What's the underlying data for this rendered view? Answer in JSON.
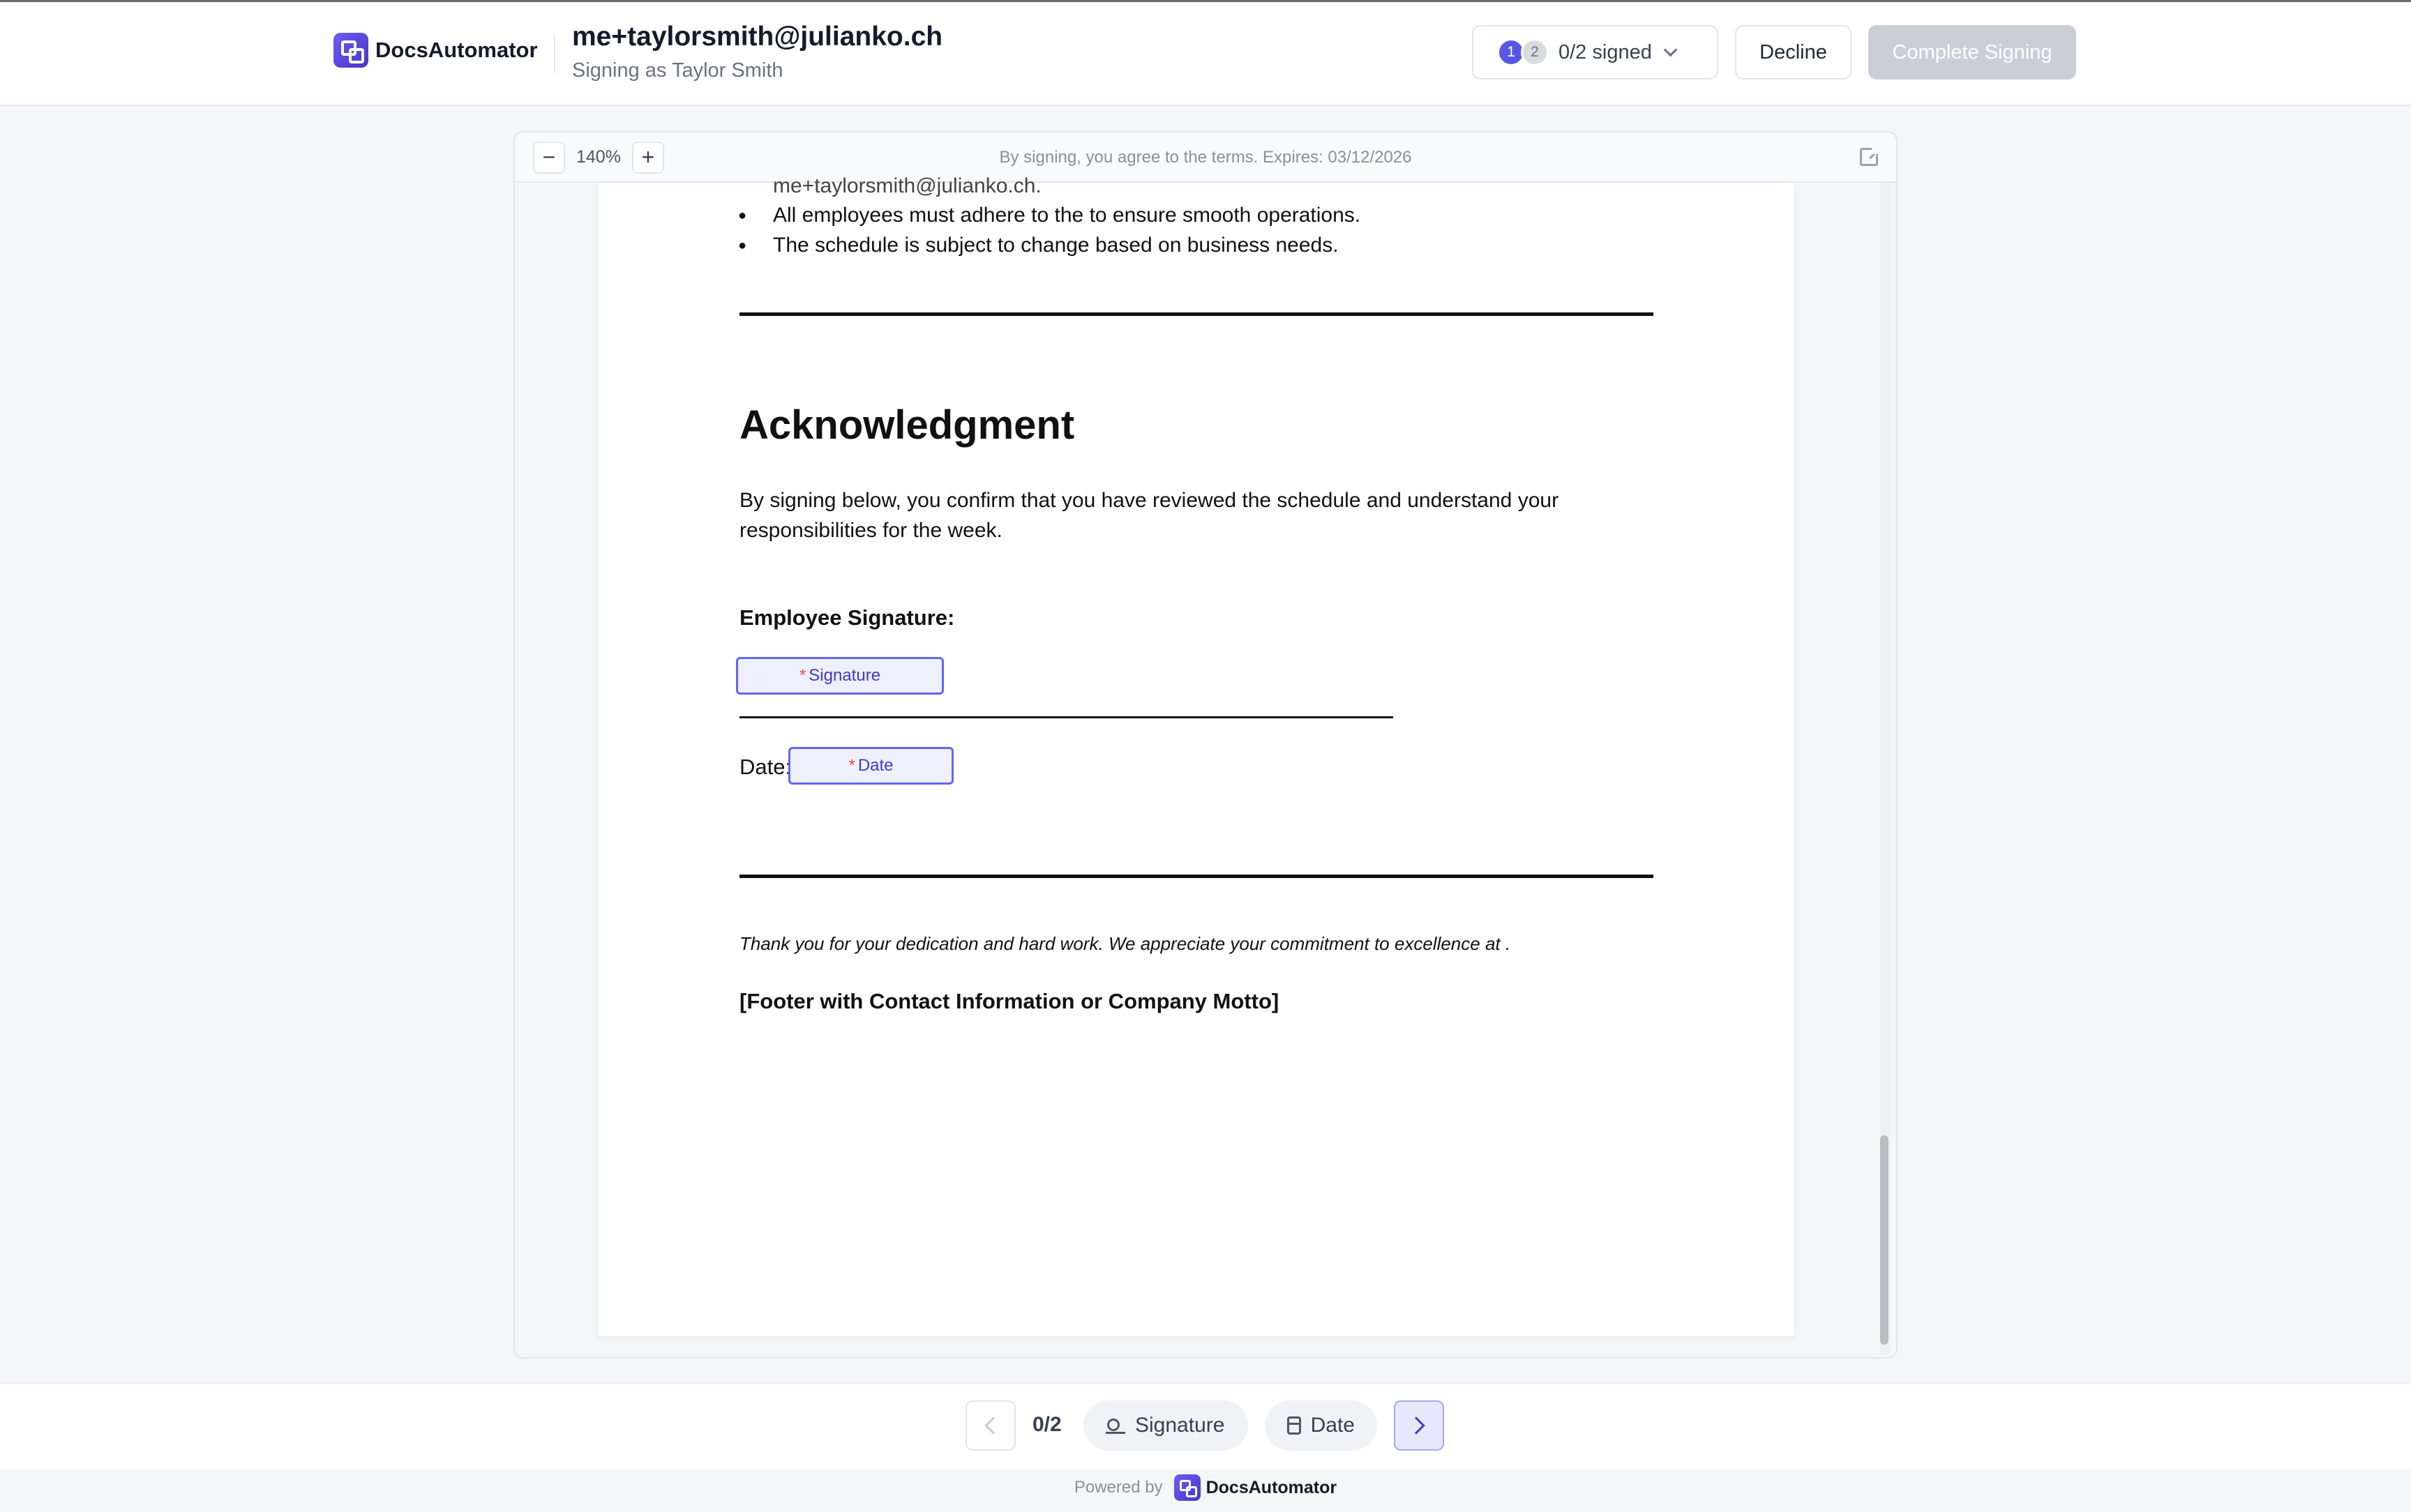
{
  "header": {
    "brand": "DocsAutomator",
    "signer_email": "me+taylorsmith@julianko.ch",
    "signer_subtitle": "Signing as Taylor Smith",
    "steps": [
      "1",
      "2"
    ],
    "progress_label": "0/2 signed",
    "decline_label": "Decline",
    "complete_label": "Complete Signing"
  },
  "viewer": {
    "zoom_level": "140%",
    "terms_text": "By signing, you agree to the terms. Expires: 03/12/2026"
  },
  "document": {
    "cut_line": "me+taylorsmith@julianko.ch.",
    "bullets": [
      "All employees must adhere to the  to ensure smooth operations.",
      "The schedule is subject to change based on business needs."
    ],
    "heading": "Acknowledgment",
    "paragraph": "By signing below, you confirm that you have reviewed the schedule and understand your responsibilities for the week.",
    "employee_signature_label": "Employee Signature:",
    "signature_field": "Signature",
    "date_label": "Date:",
    "date_field": "Date",
    "required_marker": "*",
    "thanks": "Thank you for your dedication and hard work. We appreciate your commitment to excellence at .",
    "footer_note": "[Footer with Contact Information or Company Motto]"
  },
  "bottom_nav": {
    "count": "0/2",
    "signature_label": "Signature",
    "date_label": "Date"
  },
  "footer": {
    "powered_by": "Powered by",
    "brand": "DocsAutomator"
  },
  "colors": {
    "accent": "#5b57e6",
    "field_border": "#6366f1",
    "field_bg": "#eef0fd",
    "required": "#ef4444",
    "complete_disabled": "#c9ced7"
  },
  "icons": [
    "logo-icon",
    "chevron-down-icon",
    "minus-icon",
    "plus-icon",
    "external-link-icon",
    "chevron-left-icon",
    "chevron-right-icon",
    "signature-icon",
    "calendar-icon"
  ]
}
